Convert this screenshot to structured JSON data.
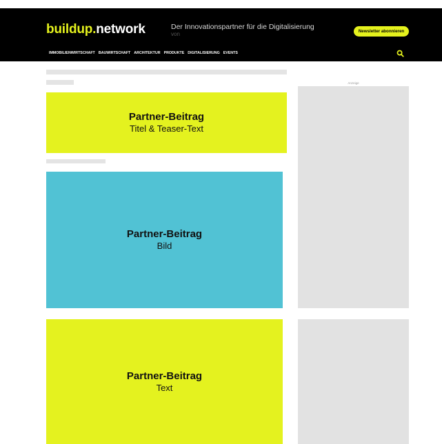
{
  "header": {
    "logo_part1": "buildup.",
    "logo_part2": "network",
    "tagline": "Der Innovationspartner für die Digitalisierung",
    "tagline_sub": "von",
    "newsletter_label": "Newsletter abonnieren",
    "nav": [
      "IMMOBILIENWIRTSCHAFT",
      "BAUWIRTSCHAFT",
      "ARCHITEKTUR",
      "PRODUKTE",
      "DIGITALISIERUNG",
      "EVENTS"
    ]
  },
  "sidebar": {
    "ad_label": "Anzeige"
  },
  "cards": [
    {
      "title": "Partner-Beitrag",
      "subtitle": "Titel & Teaser-Text"
    },
    {
      "title": "Partner-Beitrag",
      "subtitle": "Bild"
    },
    {
      "title": "Partner-Beitrag",
      "subtitle": "Text"
    }
  ],
  "colors": {
    "brand_yellow": "#e4f21f",
    "image_blue": "#51c2d4",
    "header_black": "#000000",
    "placeholder_grey": "#e4e4e4"
  },
  "icons": [
    "search-icon"
  ]
}
